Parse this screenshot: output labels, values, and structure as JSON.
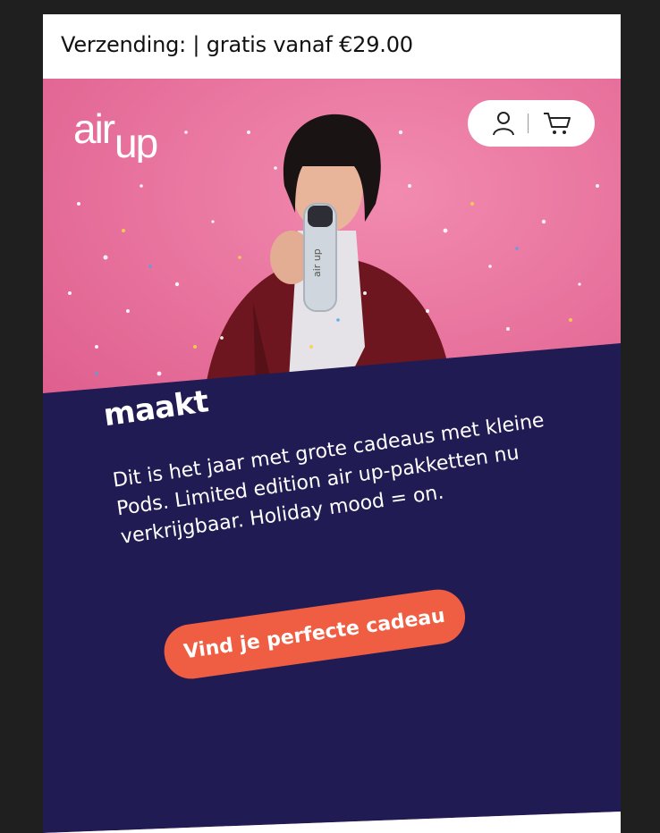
{
  "shipping": {
    "text": "Verzending: | gratis vanaf €29.00"
  },
  "brand": {
    "logo_text": "air up",
    "accent": "#ef5d42",
    "panel": "#201b52",
    "hero_bg": "#ea6f9c"
  },
  "header": {
    "account_icon": "user-icon",
    "cart_icon": "cart-icon"
  },
  "hero": {
    "headline": "maakt",
    "body": "Dit is het jaar met grote cadeaus met kleine Pods. Limited edition air up-pakketten nu verkrijgbaar. Holiday mood = on.",
    "cta_label": "Vind je perfecte cadeau"
  }
}
